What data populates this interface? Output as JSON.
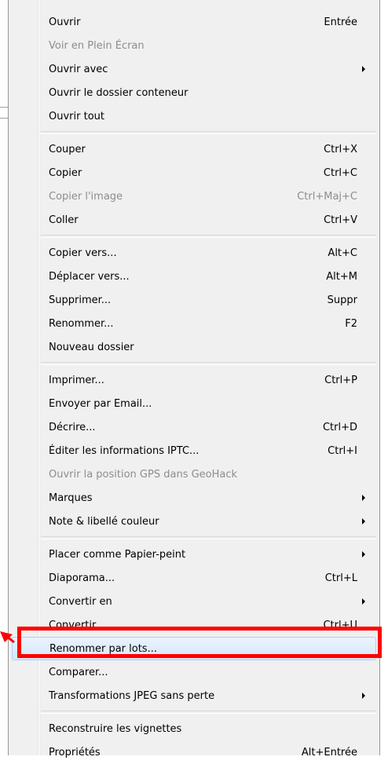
{
  "menu": {
    "items": [
      {
        "label": "Ouvrir",
        "shortcut": "Entrée",
        "disabled": false,
        "submenu": false
      },
      {
        "label": "Voir en Plein Écran",
        "shortcut": "",
        "disabled": true,
        "submenu": false
      },
      {
        "label": "Ouvrir avec",
        "shortcut": "",
        "disabled": false,
        "submenu": true
      },
      {
        "label": "Ouvrir le dossier conteneur",
        "shortcut": "",
        "disabled": false,
        "submenu": false
      },
      {
        "label": "Ouvrir tout",
        "shortcut": "",
        "disabled": false,
        "submenu": false
      },
      {
        "separator": true
      },
      {
        "label": "Couper",
        "shortcut": "Ctrl+X",
        "disabled": false,
        "submenu": false
      },
      {
        "label": "Copier",
        "shortcut": "Ctrl+C",
        "disabled": false,
        "submenu": false
      },
      {
        "label": "Copier l'image",
        "shortcut": "Ctrl+Maj+C",
        "disabled": true,
        "submenu": false
      },
      {
        "label": "Coller",
        "shortcut": "Ctrl+V",
        "disabled": false,
        "submenu": false
      },
      {
        "separator": true
      },
      {
        "label": "Copier vers...",
        "shortcut": "Alt+C",
        "disabled": false,
        "submenu": false
      },
      {
        "label": "Déplacer vers...",
        "shortcut": "Alt+M",
        "disabled": false,
        "submenu": false
      },
      {
        "label": "Supprimer...",
        "shortcut": "Suppr",
        "disabled": false,
        "submenu": false
      },
      {
        "label": "Renommer...",
        "shortcut": "F2",
        "disabled": false,
        "submenu": false
      },
      {
        "label": "Nouveau dossier",
        "shortcut": "",
        "disabled": false,
        "submenu": false
      },
      {
        "separator": true
      },
      {
        "label": "Imprimer...",
        "shortcut": "Ctrl+P",
        "disabled": false,
        "submenu": false
      },
      {
        "label": "Envoyer par Email...",
        "shortcut": "",
        "disabled": false,
        "submenu": false
      },
      {
        "label": "Décrire...",
        "shortcut": "Ctrl+D",
        "disabled": false,
        "submenu": false
      },
      {
        "label": "Éditer les informations IPTC...",
        "shortcut": "Ctrl+I",
        "disabled": false,
        "submenu": false
      },
      {
        "label": "Ouvrir la position GPS dans GeoHack",
        "shortcut": "",
        "disabled": true,
        "submenu": false
      },
      {
        "label": "Marques",
        "shortcut": "",
        "disabled": false,
        "submenu": true
      },
      {
        "label": "Note & libellé couleur",
        "shortcut": "",
        "disabled": false,
        "submenu": true
      },
      {
        "separator": true
      },
      {
        "label": "Placer comme Papier-peint",
        "shortcut": "",
        "disabled": false,
        "submenu": true
      },
      {
        "label": "Diaporama...",
        "shortcut": "Ctrl+L",
        "disabled": false,
        "submenu": false
      },
      {
        "label": "Convertir en",
        "shortcut": "",
        "disabled": false,
        "submenu": true
      },
      {
        "label": "Convertir...",
        "shortcut": "Ctrl+U",
        "disabled": false,
        "submenu": false
      },
      {
        "label": "Renommer par lots...",
        "shortcut": "",
        "disabled": false,
        "submenu": false,
        "highlighted": true
      },
      {
        "label": "Comparer...",
        "shortcut": "",
        "disabled": false,
        "submenu": false
      },
      {
        "label": "Transformations JPEG sans perte",
        "shortcut": "",
        "disabled": false,
        "submenu": true
      },
      {
        "separator": true
      },
      {
        "label": "Reconstruire les vignettes",
        "shortcut": "",
        "disabled": false,
        "submenu": false
      },
      {
        "label": "Propriétés",
        "shortcut": "Alt+Entrée",
        "disabled": false,
        "submenu": false
      }
    ]
  },
  "colors": {
    "highlight_box": "#ff0000",
    "disabled_text": "#8d8d8d",
    "menu_bg": "#f0f0f0"
  }
}
